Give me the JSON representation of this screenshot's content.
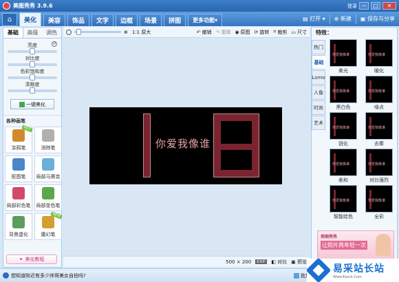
{
  "window": {
    "title": "美图秀秀 3.9.6",
    "login": "登录",
    "min": "─",
    "max": "□",
    "close": "✕"
  },
  "nav": {
    "home_icon": "home-icon",
    "tabs": [
      "美化",
      "美容",
      "饰品",
      "文字",
      "边框",
      "场景",
      "拼图"
    ],
    "more": "更多功能",
    "open": "打开",
    "new": "新建",
    "save_share": "保存与分享"
  },
  "left": {
    "subtabs": [
      "基础",
      "高级",
      "调色"
    ],
    "sliders": [
      {
        "label": "亮度",
        "value": 0.5
      },
      {
        "label": "对比度",
        "value": 0.5
      },
      {
        "label": "色彩饱和度",
        "value": 0.5
      },
      {
        "label": "清晰度",
        "value": 0.5
      }
    ],
    "one_click": "一键美化",
    "section": "各种画笔",
    "tools": [
      {
        "label": "涂鸦笔",
        "color": "#d08a2e",
        "badge": "HOT"
      },
      {
        "label": "消除笔",
        "color": "#b0b0b0",
        "badge": ""
      },
      {
        "label": "抠图笔",
        "color": "#4a86c8",
        "badge": ""
      },
      {
        "label": "局部马赛克",
        "color": "#6aaedc",
        "badge": ""
      },
      {
        "label": "局部彩色笔",
        "color": "#d04a6a",
        "badge": ""
      },
      {
        "label": "局部变色笔",
        "color": "#5aa84a",
        "badge": ""
      },
      {
        "label": "背景虚化",
        "color": "#5c9c5c",
        "badge": ""
      },
      {
        "label": "魔幻笔",
        "color": "#d0a030",
        "badge": "NEW"
      }
    ],
    "tutorial": "美化教程"
  },
  "toolbar": {
    "zoom_level": 0.05,
    "original_size": "1:1 原大",
    "undo": "撤销",
    "redo": "重做",
    "original": "原图",
    "rotate": "旋转",
    "crop": "裁剪",
    "resize": "尺寸"
  },
  "canvas": {
    "text": "你爱我像谁"
  },
  "status": {
    "size": "500 × 200",
    "exif": "EXIF",
    "compare": "对比",
    "preview": "预览"
  },
  "right": {
    "title": "特效：",
    "categories": [
      "热门",
      "基础",
      "Lomo",
      "人像",
      "时尚",
      "艺术"
    ],
    "effects": [
      "柔光",
      "暖化",
      "黑白色",
      "噪点",
      "锐化",
      "去雾",
      "柔和",
      "对比强烈",
      "智能绘色",
      "全彩"
    ],
    "thumb_text": "你爱我像谁",
    "ad_title": "美图秀秀",
    "ad_text": "让照片再年轻一次"
  },
  "bottom": {
    "tip": "想知道附近有多少帅哥美女自拍吗?",
    "batch": "批处理"
  },
  "watermark": {
    "cn": "易采站长站",
    "en": "Www.Easck.Com"
  }
}
